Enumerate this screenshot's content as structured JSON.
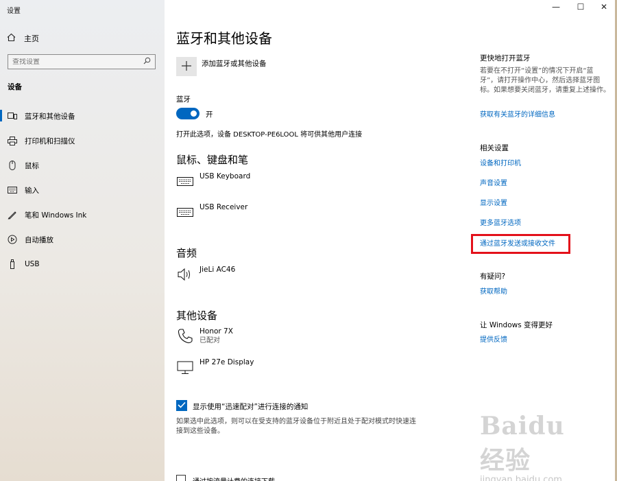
{
  "window": {
    "title": "设置",
    "controls": {
      "minimize": "—",
      "maximize": "☐",
      "close": "✕"
    }
  },
  "sidebar": {
    "home_label": "主页",
    "search_placeholder": "查找设置",
    "section_label": "设备",
    "items": [
      {
        "label": "蓝牙和其他设备",
        "icon": "devices-icon",
        "active": true
      },
      {
        "label": "打印机和扫描仪",
        "icon": "printer-icon",
        "active": false
      },
      {
        "label": "鼠标",
        "icon": "mouse-icon",
        "active": false
      },
      {
        "label": "输入",
        "icon": "keyboard-icon",
        "active": false
      },
      {
        "label": "笔和 Windows Ink",
        "icon": "pen-icon",
        "active": false
      },
      {
        "label": "自动播放",
        "icon": "autoplay-icon",
        "active": false
      },
      {
        "label": "USB",
        "icon": "usb-icon",
        "active": false
      }
    ]
  },
  "main": {
    "title": "蓝牙和其他设备",
    "add_device_label": "添加蓝牙或其他设备",
    "bluetooth_label": "蓝牙",
    "bluetooth_state": "开",
    "discoverable_text": "打开此选项，设备 DESKTOP-PE6LOOL 将可供其他用户连接",
    "groups": {
      "mouse_keyboard_pen": {
        "header": "鼠标、键盘和笔",
        "devices": [
          {
            "name": "USB Keyboard",
            "icon": "keyboard-icon"
          },
          {
            "name": "USB Receiver",
            "icon": "keyboard-icon"
          }
        ]
      },
      "audio": {
        "header": "音频",
        "devices": [
          {
            "name": "JieLi AC46",
            "icon": "speaker-icon"
          }
        ]
      },
      "other": {
        "header": "其他设备",
        "devices": [
          {
            "name": "Honor 7X",
            "status": "已配对",
            "icon": "phone-icon"
          },
          {
            "name": "HP 27e Display",
            "icon": "monitor-icon"
          }
        ]
      }
    },
    "swift_pair_label": "显示使用“迅速配对”进行连接的通知",
    "swift_pair_checked": true,
    "swift_pair_desc": "如果选中此选项，则可以在受支持的蓝牙设备位于附近且处于配对模式时快速连接到这些设备。",
    "metered_label": "通过按流量计费的连接下载"
  },
  "right": {
    "quick_header": "更快地打开蓝牙",
    "quick_text": "若要在不打开“设置”的情况下开启“蓝牙”，请打开操作中心，然后选择蓝牙图标。如果想要关闭蓝牙，请重复上述操作。",
    "quick_link": "获取有关蓝牙的详细信息",
    "related_header": "相关设置",
    "related_links": [
      "设备和打印机",
      "声音设置",
      "显示设置",
      "更多蓝牙选项",
      "通过蓝牙发送或接收文件"
    ],
    "question_header": "有疑问?",
    "question_link": "获取帮助",
    "improve_header": "让 Windows 变得更好",
    "improve_link": "提供反馈"
  },
  "watermark": {
    "logo": "Baidu经验",
    "url": "jingyan.baidu.com"
  },
  "colors": {
    "accent": "#0067c0",
    "highlight_box": "#e3101a"
  }
}
